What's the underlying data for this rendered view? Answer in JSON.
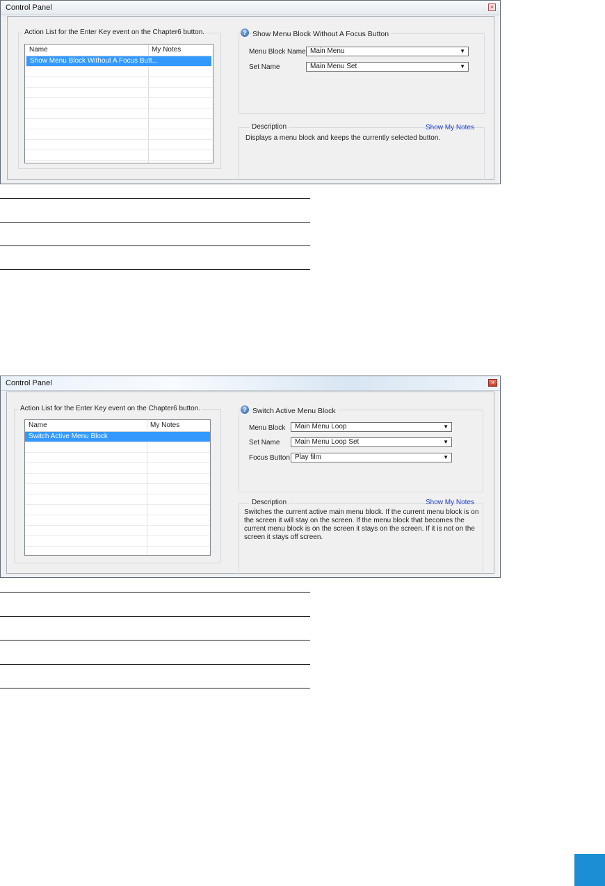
{
  "window1": {
    "title": "Control Panel",
    "close_glyph": "×",
    "action_list": {
      "label": "Action List for the Enter Key event on the Chapter6 button.",
      "columns": [
        "Name",
        "My Notes"
      ],
      "rows": [
        {
          "name": "Show Menu Block Without A Focus Butt...",
          "notes": "",
          "selected": true
        }
      ]
    },
    "action": {
      "icon": "info-icon",
      "title": "Show Menu Block Without A Focus Button",
      "fields": [
        {
          "label": "Menu Block Name",
          "value": "Main Menu"
        },
        {
          "label": "Set Name",
          "value": "Main Menu Set"
        }
      ]
    },
    "description": {
      "label": "Description",
      "link": "Show My Notes",
      "text": "Displays a menu block and keeps the currently selected button."
    }
  },
  "window2": {
    "title": "Control Panel",
    "close_glyph": "×",
    "action_list": {
      "label": "Action List for the Enter Key event on the Chapter6 button.",
      "columns": [
        "Name",
        "My Notes"
      ],
      "rows": [
        {
          "name": "Switch Active Menu Block",
          "notes": "",
          "selected": true
        }
      ]
    },
    "action": {
      "icon": "info-icon",
      "title": "Switch Active Menu Block",
      "fields": [
        {
          "label": "Menu Block",
          "value": "Main Menu Loop"
        },
        {
          "label": "Set Name",
          "value": "Main Menu Loop Set"
        },
        {
          "label": "Focus Button",
          "value": "Play film"
        }
      ]
    },
    "description": {
      "label": "Description",
      "link": "Show My Notes",
      "text": "Switches the current active main menu block.  If the current menu block is on the screen it will stay on the screen. If the menu block that becomes the current menu block is on the screen it stays on the screen.  If it is not on the screen it stays off screen."
    }
  },
  "colors": {
    "selection": "#3399ff",
    "link": "#1c3fd0",
    "page_tab": "#1c8fd4"
  }
}
